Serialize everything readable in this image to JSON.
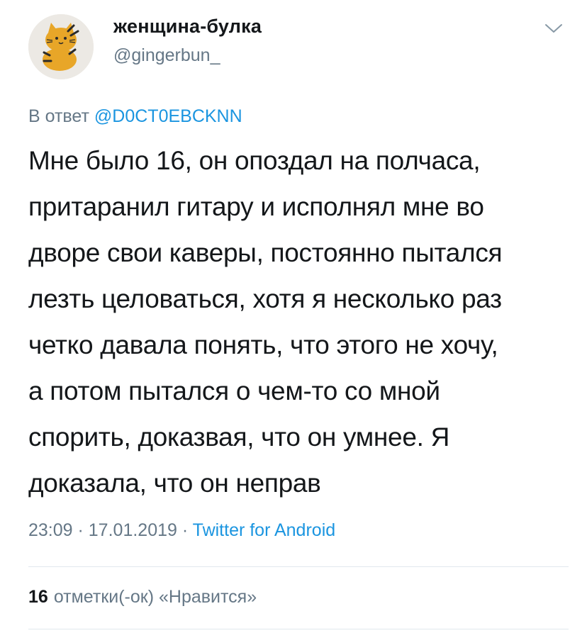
{
  "author": {
    "display_name": "женщина-булка",
    "handle": "@gingerbun_",
    "avatar_icon": "tiger-cat-avatar-icon"
  },
  "header": {
    "menu_icon": "chevron-down-icon"
  },
  "reply": {
    "prefix": "В ответ",
    "mention": "@D0CT0EBCKNN"
  },
  "tweet": {
    "lines": [
      "Мне было 16, он опоздал на полчаса,",
      "притаранил гитару и исполнял мне во",
      "дворе свои каверы, постоянно пытался",
      "лезть целоваться, хотя я несколько раз",
      "четко давала понять, что этого не хочу,",
      "а потом пытался о чем-то со мной",
      "спорить, доказвая, что он умнее. Я",
      "доказала, что он неправ"
    ]
  },
  "meta": {
    "time": "23:09",
    "sep1": " · ",
    "date": "17.01.2019",
    "sep2": " · ",
    "source": "Twitter for Android"
  },
  "likes": {
    "count": "16",
    "label": "отметки(-ок) «Нравится»"
  },
  "colors": {
    "text": "#14171a",
    "secondary": "#657786",
    "link": "#1b95e0",
    "divider": "#e1e8ed"
  }
}
